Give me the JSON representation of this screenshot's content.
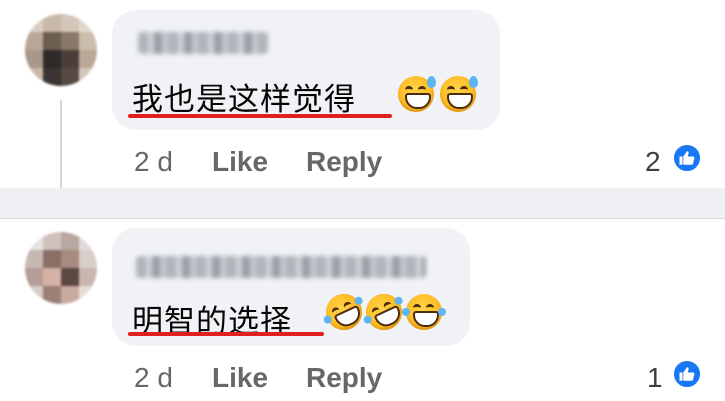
{
  "comments": [
    {
      "text": "我也是这样觉得",
      "emojis": [
        "grinning-sweat",
        "grinning-sweat"
      ],
      "time": "2 d",
      "like_label": "Like",
      "reply_label": "Reply",
      "reaction_count": "2"
    },
    {
      "text": "明智的选择",
      "emojis": [
        "rofl",
        "rofl",
        "tears-of-joy"
      ],
      "time": "2 d",
      "like_label": "Like",
      "reply_label": "Reply",
      "reaction_count": "1"
    }
  ],
  "colors": {
    "bubble": "#f0f2f5",
    "underline": "#e0201e",
    "like_badge": "#1877f2",
    "secondary_text": "#65676b"
  }
}
